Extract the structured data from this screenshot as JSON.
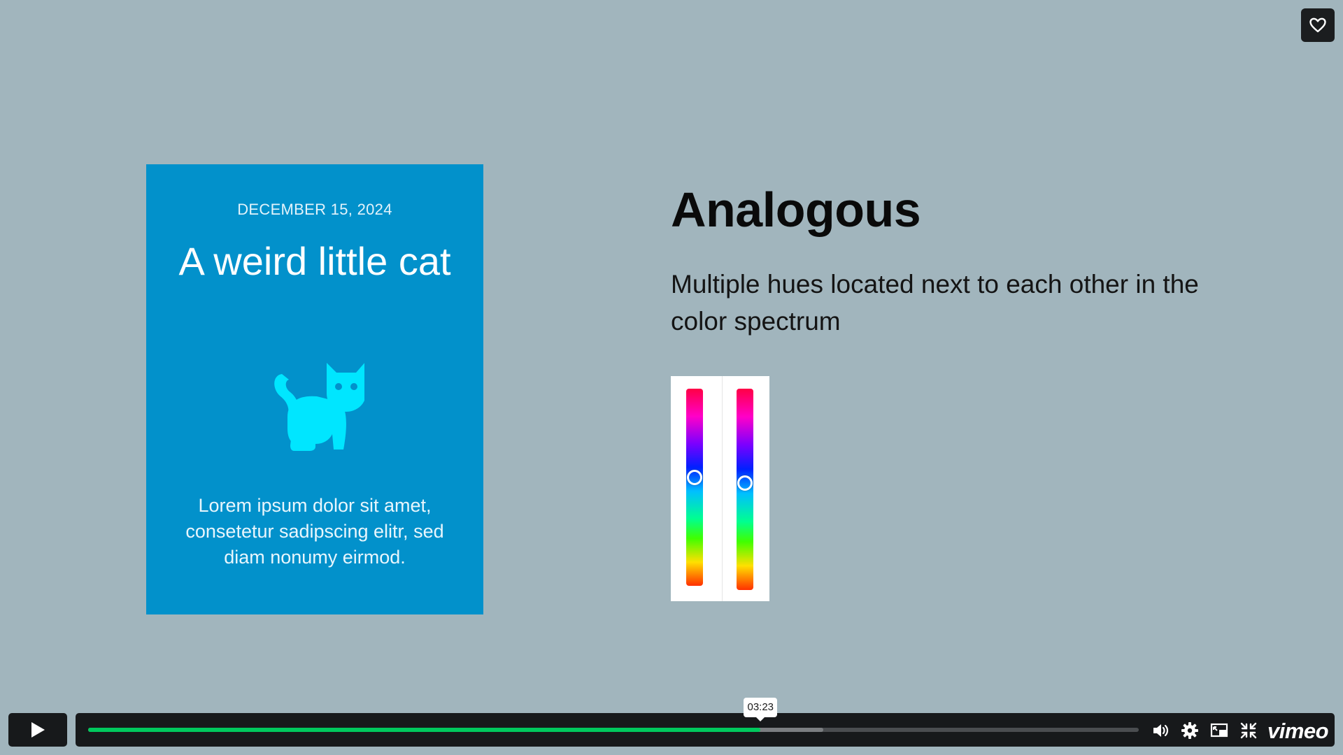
{
  "slide": {
    "card": {
      "date": "DECEMBER 15, 2024",
      "title": "A weird little cat",
      "body": "Lorem ipsum dolor sit amet, consetetur sadipscing elitr, sed diam nonumy eirmod.",
      "icon": "cat-icon"
    },
    "heading": "Analogous",
    "description": "Multiple hues located next to each other in the color spectrum",
    "hue_sliders": [
      {
        "level": 0.45
      },
      {
        "level": 0.47
      }
    ]
  },
  "player": {
    "current_time": "03:23",
    "progress_played": 0.64,
    "progress_buffered": 0.7,
    "icons": [
      "heart-icon",
      "play-icon",
      "volume-icon",
      "settings-icon",
      "pip-icon",
      "exit-fullscreen-icon"
    ],
    "brand": "vimeo",
    "accent_color": "#00c95d",
    "background_color": "#a1b5bd"
  }
}
